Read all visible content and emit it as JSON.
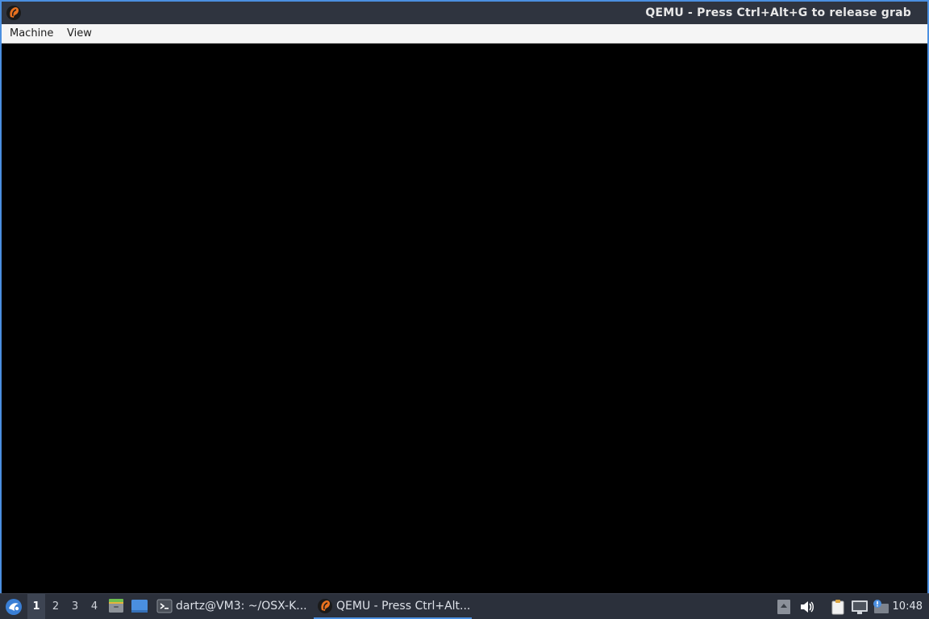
{
  "window": {
    "title": "QEMU - Press Ctrl+Alt+G to release grab",
    "icon": "qemu-icon"
  },
  "menubar": {
    "items": [
      "Machine",
      "View"
    ]
  },
  "taskbar": {
    "start_icon": "lxqt-start-icon",
    "workspaces": [
      "1",
      "2",
      "3",
      "4"
    ],
    "active_workspace": "1",
    "launchers": [
      "file-manager-icon",
      "show-desktop-icon"
    ],
    "tasks": [
      {
        "label": "dartz@VM3: ~/OSX-K...",
        "icon": "terminal-icon",
        "active": false
      },
      {
        "label": "QEMU - Press Ctrl+Alt...",
        "icon": "qemu-icon",
        "active": true
      }
    ],
    "tray": [
      "tray-arrow-icon",
      "volume-icon",
      "clipboard-icon",
      "network-icon",
      "notification-icon"
    ],
    "clock": "10:48"
  },
  "colors": {
    "titlebar_bg": "#2f343f",
    "window_border": "#4b8fe0",
    "menubar_bg": "#f5f5f5",
    "taskbar_bg": "#2b303b",
    "accent": "#4b8fe0"
  }
}
